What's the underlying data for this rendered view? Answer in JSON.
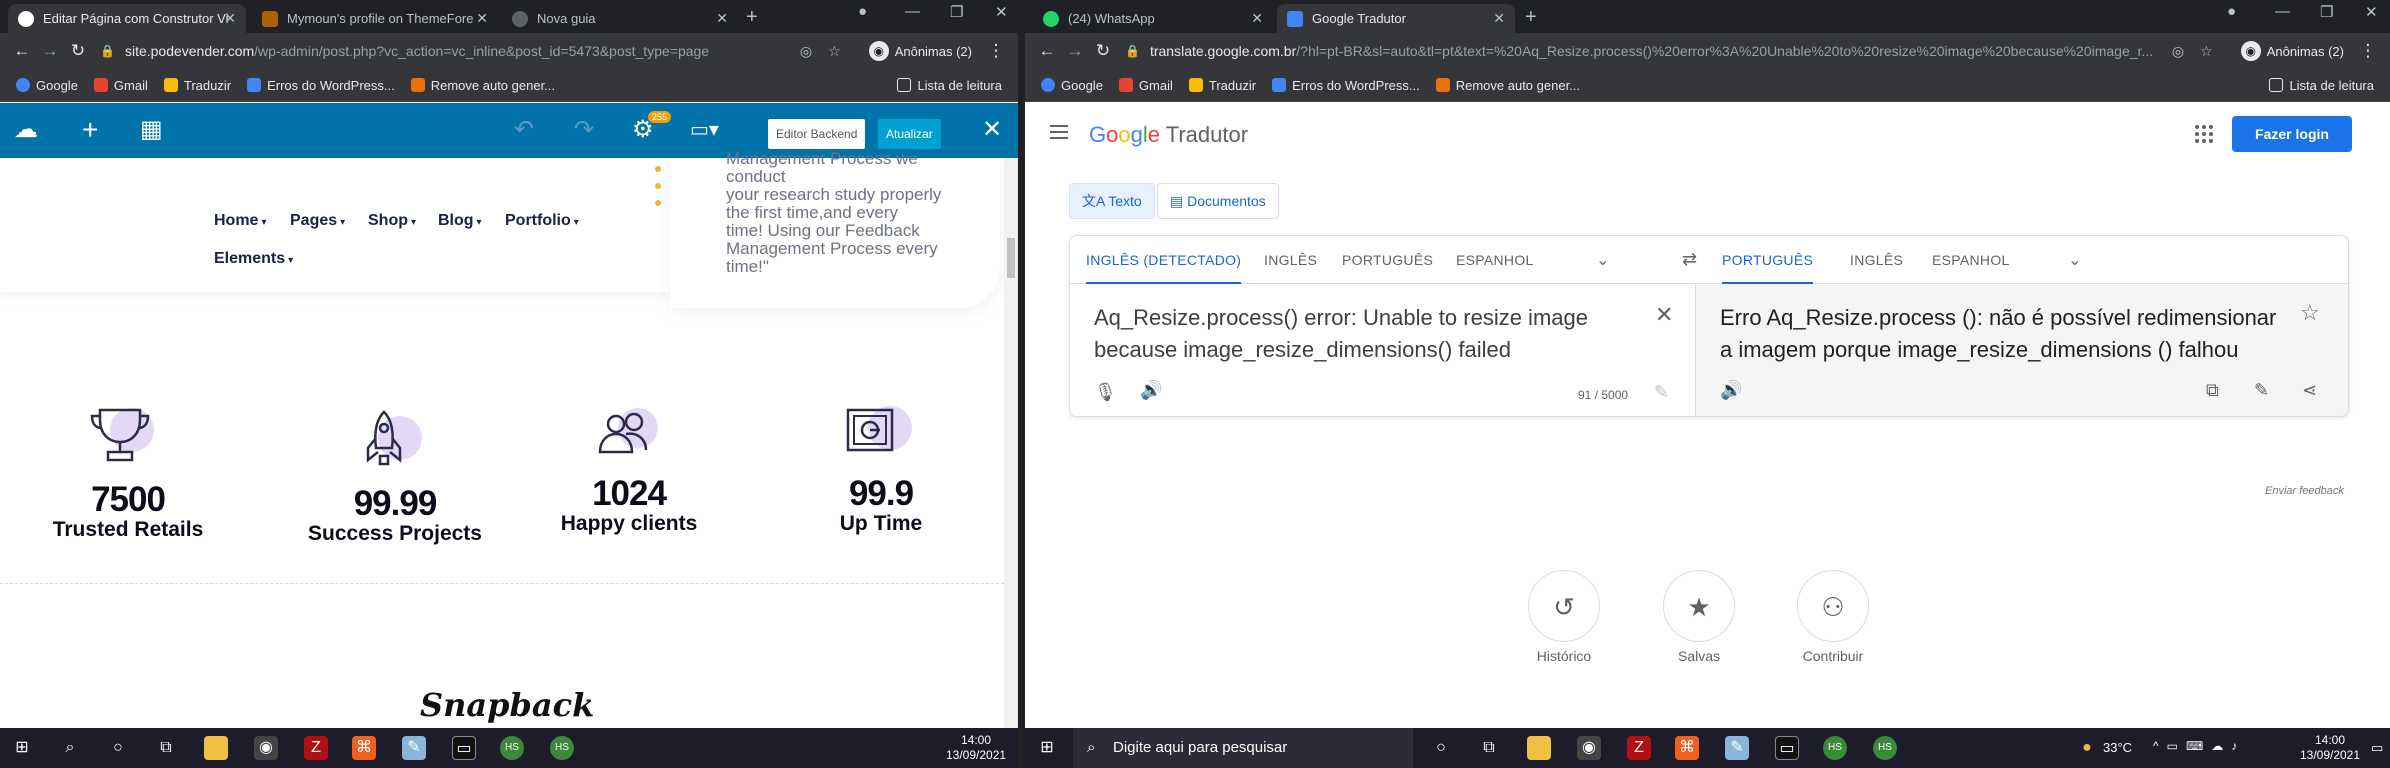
{
  "left_browser": {
    "tabs": [
      {
        "title": "Editar Página com Construtor Vi",
        "color": "#ffffff"
      },
      {
        "title": "Mymoun's profile on ThemeFore",
        "color": "#b06000"
      },
      {
        "title": "Nova guia",
        "color": "#9aa0a6"
      }
    ],
    "url_host": "site.podevender.com",
    "url_path": "/wp-admin/post.php?vc_action=vc_inline&post_id=5473&post_type=page",
    "profile_label": "Anônimas (2)",
    "bookmarks": [
      "Google",
      "Gmail",
      "Traduzir",
      "Erros do WordPress...",
      "Remove auto gener..."
    ],
    "reading_list": "Lista de leitura"
  },
  "wp_editor": {
    "badge": "255",
    "editor_backend_label": "Editor Backend",
    "update_label": "Atualizar"
  },
  "site": {
    "menu": [
      "Home",
      "Pages",
      "Shop",
      "Blog",
      "Portfolio",
      "Elements"
    ],
    "quote_lines": [
      "Management Process we",
      "conduct",
      "your research study properly",
      "the first time,and every",
      "time! Using our Feedback",
      "Management Process every",
      "time!\""
    ],
    "stats": [
      {
        "num": "7500",
        "label": "Trusted Retails"
      },
      {
        "num": "99.99",
        "label": "Success Projects"
      },
      {
        "num": "1024",
        "label": "Happy clients"
      },
      {
        "num": "99.9",
        "label": "Up Time"
      }
    ],
    "logo_text": "Snapback"
  },
  "right_browser": {
    "tabs": [
      {
        "title": "(24) WhatsApp",
        "color": "#25d366"
      },
      {
        "title": "Google Tradutor",
        "color": "#4285f4"
      }
    ],
    "url_host": "translate.google.com.br",
    "url_path": "/?hl=pt-BR&sl=auto&tl=pt&text=%20Aq_Resize.process()%20error%3A%20Unable%20to%20resize%20image%20because%20image_r...",
    "profile_label": "Anônimas (2)",
    "bookmarks": [
      "Google",
      "Gmail",
      "Traduzir",
      "Erros do WordPress...",
      "Remove auto gener..."
    ],
    "reading_list": "Lista de leitura"
  },
  "translate": {
    "app_name": "Tradutor",
    "login_label": "Fazer login",
    "mode_text": "Texto",
    "mode_docs": "Documentos",
    "source_langs": [
      "INGLÊS (DETECTADO)",
      "INGLÊS",
      "PORTUGUÊS",
      "ESPANHOL"
    ],
    "target_langs": [
      "PORTUGUÊS",
      "INGLÊS",
      "ESPANHOL"
    ],
    "source_text": "Aq_Resize.process() error: Unable to resize image because image_resize_dimensions() failed",
    "char_count": "91 / 5000",
    "target_text": "Erro Aq_Resize.process (): não é possível redimensionar a imagem porque image_resize_dimensions () falhou",
    "feedback": "Enviar feedback",
    "actions": [
      {
        "label": "Histórico",
        "icon": "history-icon"
      },
      {
        "label": "Salvas",
        "icon": "star-icon"
      },
      {
        "label": "Contribuir",
        "icon": "contribute-icon"
      }
    ]
  },
  "taskbar": {
    "left_time": "14:00",
    "left_date": "13/09/2021",
    "search_placeholder": "Digite aqui para pesquisar",
    "temperature": "33°C",
    "right_time": "14:00",
    "right_date": "13/09/2021"
  },
  "colors": {
    "wp_blue": "#0073aa",
    "google_blue": "#1a73e8",
    "accent_gold": "#f6b23a"
  }
}
